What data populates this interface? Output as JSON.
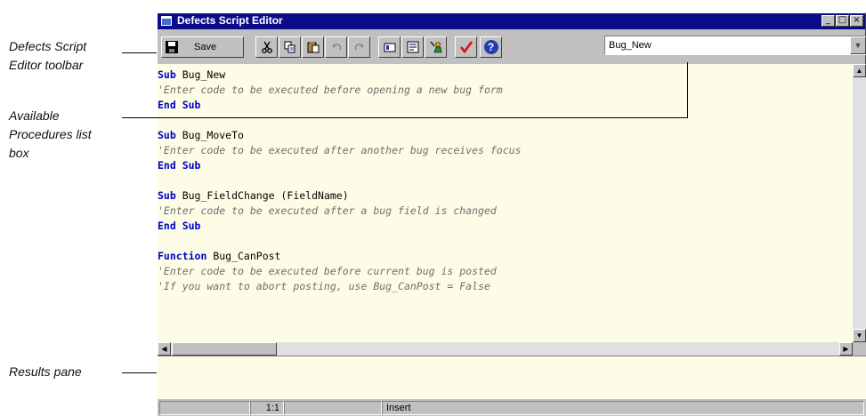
{
  "callouts": {
    "toolbar_line1": "Defects Script",
    "toolbar_line2": "Editor toolbar",
    "procedures_line1": "Available",
    "procedures_line2": "Procedures list",
    "procedures_line3": "box",
    "results": "Results pane"
  },
  "window": {
    "title": "Defects Script Editor",
    "min_glyph": "_",
    "max_glyph": "□",
    "close_glyph": "×"
  },
  "toolbar": {
    "save_label": "Save",
    "tools": [
      "cut",
      "copy",
      "paste",
      "undo",
      "redo",
      "insert-field",
      "insert-procedure",
      "user-properties",
      "syntax-check",
      "help"
    ],
    "procedure_selected": "Bug_New"
  },
  "editor": {
    "lines": [
      {
        "k": "kw",
        "a": "Sub",
        "b": " Bug_New"
      },
      {
        "k": "cm",
        "a": "",
        "b": "'Enter code to be executed before opening a new bug form"
      },
      {
        "k": "kw",
        "a": "End Sub",
        "b": ""
      },
      {
        "k": "blank",
        "a": "",
        "b": ""
      },
      {
        "k": "kw",
        "a": "Sub",
        "b": " Bug_MoveTo"
      },
      {
        "k": "cm",
        "a": "",
        "b": "'Enter code to be executed after another bug receives focus"
      },
      {
        "k": "kw",
        "a": "End Sub",
        "b": ""
      },
      {
        "k": "blank",
        "a": "",
        "b": ""
      },
      {
        "k": "kw",
        "a": "Sub",
        "b": " Bug_FieldChange (FieldName)"
      },
      {
        "k": "cm",
        "a": "",
        "b": "'Enter code to be executed after a bug field is changed"
      },
      {
        "k": "kw",
        "a": "End Sub",
        "b": ""
      },
      {
        "k": "blank",
        "a": "",
        "b": ""
      },
      {
        "k": "kw",
        "a": "Function",
        "b": " Bug_CanPost"
      },
      {
        "k": "cm",
        "a": "",
        "b": "'Enter code to be executed before current bug is posted"
      },
      {
        "k": "cm",
        "a": "",
        "b": "'If you want to abort posting, use Bug_CanPost = False"
      }
    ]
  },
  "statusbar": {
    "position": "1:1",
    "mode": "Insert"
  },
  "colors": {
    "titlebar": "#0c0c8a",
    "editor_bg": "#fdfde7",
    "keyword": "#0000c8",
    "comment": "#6e6e6e",
    "checkmark": "#d81010"
  }
}
